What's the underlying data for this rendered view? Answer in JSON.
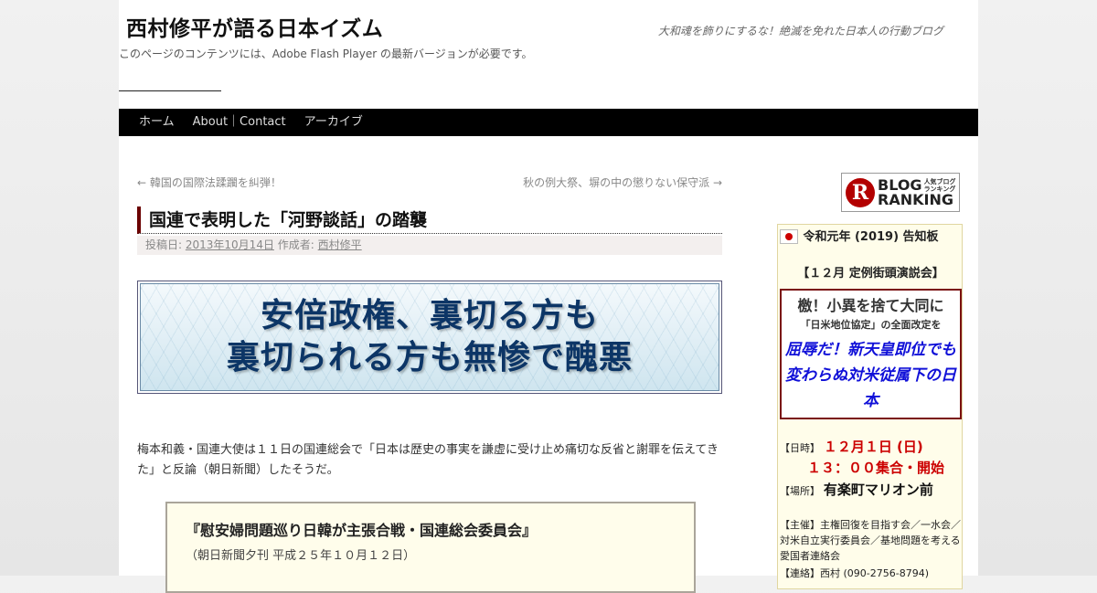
{
  "header": {
    "site_title": "西村修平が語る日本イズム",
    "site_description": "大和魂を飾りにするな！絶滅を免れた日本人の行動ブログ",
    "flash_notice": "このページのコンテンツには、Adobe Flash Player の最新バージョンが必要です。"
  },
  "nav": {
    "items": [
      {
        "label": "ホーム"
      },
      {
        "label": "About｜Contact"
      },
      {
        "label": "アーカイブ"
      }
    ]
  },
  "post_nav": {
    "prev": "← 韓国の国際法蹂躙を糾弾！",
    "next": "秋の例大祭、塀の中の懲りない保守派 →"
  },
  "post": {
    "title": "国連で表明した「河野談話」の踏襲",
    "meta_prefix": "投稿日:",
    "date": "2013年10月14日",
    "author_prefix": "作成者:",
    "author": "西村修平",
    "banner_line1": "安倍政権、裏切る方も",
    "banner_line2": "裏切られる方も無惨で醜悪",
    "body_line1": "梅本和義・国連大使は１１日の国連総会で「日本は歴史の事実を謙虚に受け止め痛切な反省と謝罪を伝えてき",
    "body_line2": "た」と反論（朝日新聞）したそうだ。",
    "quote_title": "『慰安婦問題巡り日韓が主張合戦・国連総会委員会』",
    "quote_source": "（朝日新聞夕刊 平成２５年１０月１２日）"
  },
  "sidebar": {
    "ranking_logo_letter": "R",
    "ranking_line1": "BLOG",
    "ranking_line2": "RANKING",
    "ranking_small1": "人気ブログ",
    "ranking_small2": "ランキング",
    "notice_heading": "令和元年 (2019) 告知板",
    "event_title": "【１２月 定例街頭演説会】",
    "slogan_line1": "檄！小異を捨て大同に",
    "slogan_line2": "「日米地位協定」の全面改定を",
    "slogan_line3": "屈辱だ！新天皇即位でも変わらぬ対米従属下の日本",
    "date_label": "【日時】",
    "date_value": "１２月１日 (日)",
    "time_value": "１３：００集合・開始",
    "place_label": "【場所】",
    "place_value": "有楽町マリオン前",
    "sponsor_text": "【主催】主権回復を目指す会／一水会／対米自立実行委員会／基地問題を考える愛国者連絡会",
    "contact_text": "【連絡】西村 (090-2756-8794)"
  }
}
